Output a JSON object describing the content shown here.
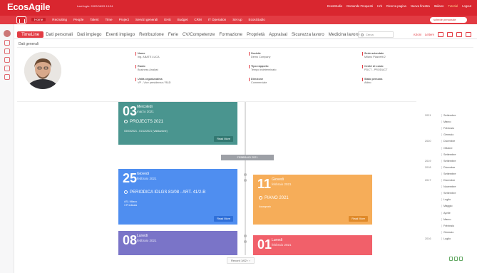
{
  "header": {
    "logo": "EcosAgile",
    "last_login": "Last login: 2022/06/29 19:34",
    "links": [
      "EcosStudio",
      "Domande Frequenti",
      "Hrb",
      "Ricerca pagina",
      "Nuova finestra",
      "Italiano",
      "Tutorial",
      "Logout"
    ]
  },
  "menu": {
    "items": [
      "Home",
      "Recruiting",
      "People",
      "Talent",
      "Time",
      "Project",
      "Servizi generali",
      "EHS",
      "Budget",
      "CRM",
      "IT Operation",
      "Set up",
      "EcosStudio"
    ],
    "search_chip": "schede personale"
  },
  "tabs": {
    "items": [
      "TimeLine",
      "Dati personali",
      "Dati impiego",
      "Eventi impiego",
      "Retribuzione",
      "Ferie",
      "CV/Competenze",
      "Formazione",
      "Proprietà",
      "Appraisal",
      "Sicurezza lavoro",
      "Medicina lavoro"
    ],
    "search_placeholder": "Cerca",
    "tools": [
      "Azioni",
      "Lettere"
    ]
  },
  "general": {
    "label": "Dati generali",
    "fields": [
      {
        "label": "Nome",
        "value": "Ing. ABATE LUCA"
      },
      {
        "label": "Società",
        "value": "Demo Company"
      },
      {
        "label": "Sede aziendale",
        "value": "Milano Piazzetti 2"
      },
      {
        "label": "Ruolo",
        "value": "Business Analyst"
      },
      {
        "label": "Tipo rapporto",
        "value": "Tempo indeterminato"
      },
      {
        "label": "Centri di costo",
        "value": "PDCT - PRODUCT"
      },
      {
        "label": "Unità organizzativa",
        "value": "VP - Vice presidenza / R&D"
      },
      {
        "label": "Direzione",
        "value": "Commerciale"
      },
      {
        "label": "Stato persona",
        "value": "Attivo"
      }
    ]
  },
  "timeline": {
    "read_more": "Read More",
    "month_marker": "FEBBRAIO 2021",
    "cards": [
      {
        "day": "03",
        "dow": "Mercoledi",
        "month": "marzo 2021",
        "title": "PROJECTS 2021",
        "meta": "03/03/2021 - 01/12/2021 (Validazione)"
      },
      {
        "day": "25",
        "dow": "Giovedi",
        "month": "febbraio 2021",
        "title": "PERIODICA IDLGS 81/08 - ART. 41/2-B",
        "meta1": "ASL Milano",
        "meta2": "3 Predicata"
      },
      {
        "day": "11",
        "dow": "Giovedi",
        "month": "febbraio 2021",
        "title": "PIANO 2021",
        "meta": "Assegnato"
      },
      {
        "day": "08",
        "dow": "Lunedi",
        "month": "febbraio 2021",
        "title": ""
      },
      {
        "day": "01",
        "dow": "Lunedi",
        "month": "febbraio 2021",
        "title": ""
      }
    ]
  },
  "datenav": {
    "rows": [
      {
        "year": "2021",
        "month": "Settembre"
      },
      {
        "year": "",
        "month": "Marzo"
      },
      {
        "year": "",
        "month": "Febbraio"
      },
      {
        "year": "",
        "month": "Gennaio"
      },
      {
        "year": "2020",
        "month": "Dicembre"
      },
      {
        "year": "",
        "month": "Ottobre"
      },
      {
        "year": "",
        "month": "Settembre"
      },
      {
        "year": "2019",
        "month": "Settembre"
      },
      {
        "year": "2018",
        "month": "Dicembre"
      },
      {
        "year": "",
        "month": "Settembre"
      },
      {
        "year": "2017",
        "month": "Dicembre"
      },
      {
        "year": "",
        "month": "Novembre"
      },
      {
        "year": "",
        "month": "Settembre"
      },
      {
        "year": "",
        "month": "Luglio"
      },
      {
        "year": "",
        "month": "Maggio"
      },
      {
        "year": "",
        "month": "Aprile"
      },
      {
        "year": "",
        "month": "Marzo"
      },
      {
        "year": "",
        "month": "Febbraio"
      },
      {
        "year": "",
        "month": "Gennaio"
      },
      {
        "year": "2016",
        "month": "Luglio"
      }
    ]
  },
  "pager": "Record 1/62  ‹  ›"
}
